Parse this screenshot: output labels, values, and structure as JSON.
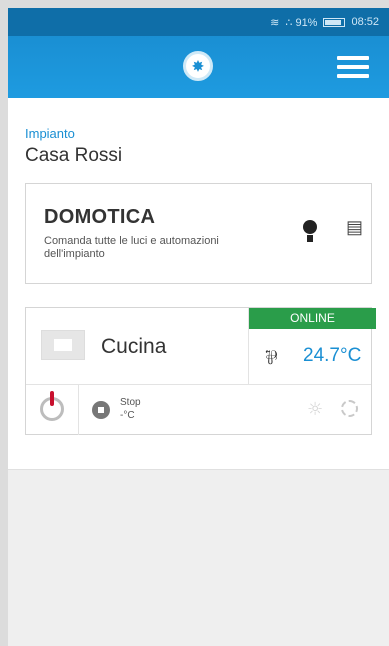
{
  "status_bar": {
    "wifi_icon": "wifi-icon",
    "signal": "∴ 91%",
    "time": "08:52"
  },
  "app_bar": {
    "logo_icon": "logo-icon",
    "menu_icon": "hamburger-menu-icon"
  },
  "plant": {
    "label": "Impianto",
    "name": "Casa Rossi"
  },
  "domotica": {
    "title": "DOMOTICA",
    "subtitle": "Comanda tutte le luci e automazioni dell'impianto",
    "icons": [
      "lightbulb-icon",
      "shutter-icon"
    ]
  },
  "zone": {
    "name": "Cucina",
    "status": "ONLINE",
    "status_color": "#2a9d4a",
    "temperature": "24.7°C",
    "mode_label": "Stop",
    "setpoint": "-°C",
    "icons": [
      "power-icon",
      "stop-icon",
      "sun-icon",
      "loading-icon",
      "radiator-icon"
    ]
  },
  "colors": {
    "primary": "#1a8fd3",
    "power_accent": "#c8102e"
  }
}
